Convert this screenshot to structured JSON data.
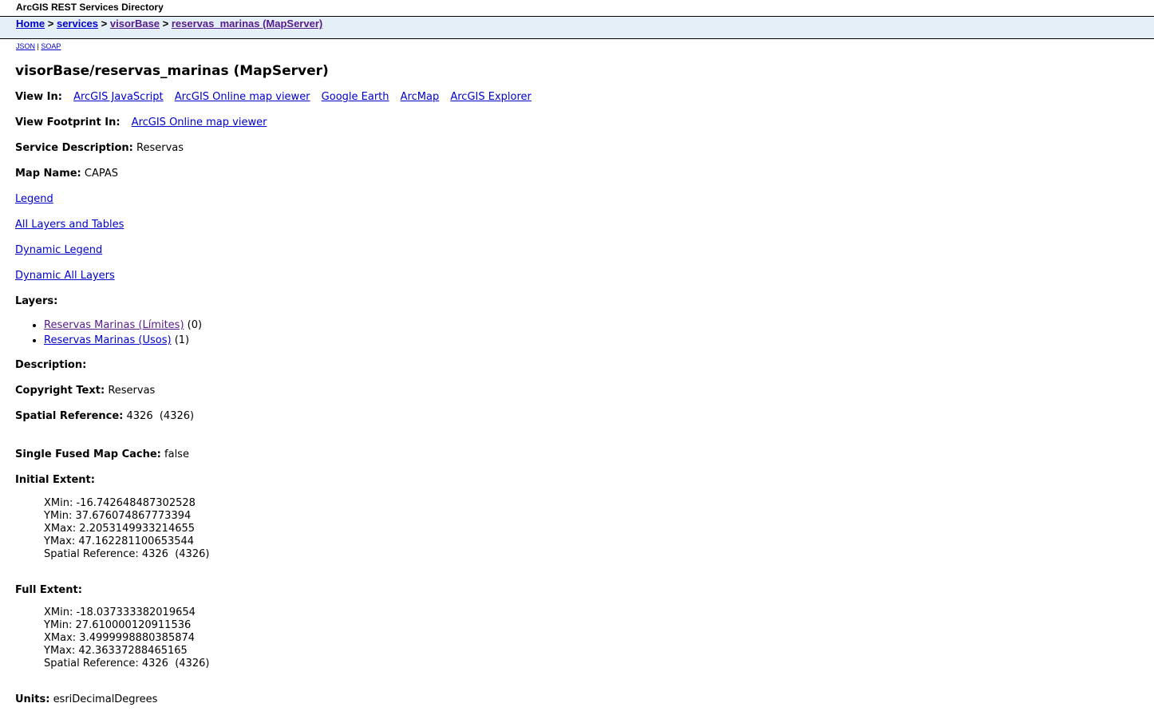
{
  "window": {
    "title": "ArcGIS REST Services Directory"
  },
  "breadcrumb": {
    "items": [
      {
        "label": "Home"
      },
      {
        "label": "services"
      },
      {
        "label": "visorBase"
      },
      {
        "label": "reservas_marinas (MapServer)"
      }
    ],
    "separator": ">"
  },
  "formats": {
    "json": "JSON",
    "separator": "|",
    "soap": "SOAP"
  },
  "page_title": "visorBase/reservas_marinas (MapServer)",
  "view_in": {
    "label": "View In:",
    "links": [
      "ArcGIS JavaScript",
      "ArcGIS Online map viewer",
      "Google Earth",
      "ArcMap",
      "ArcGIS Explorer"
    ]
  },
  "view_footprint": {
    "label": "View Footprint In:",
    "link": "ArcGIS Online map viewer"
  },
  "service_description": {
    "label": "Service Description:",
    "value": "Reservas"
  },
  "map_name": {
    "label": "Map Name:",
    "value": "CAPAS"
  },
  "links": {
    "legend": "Legend",
    "all_layers": "All Layers and Tables",
    "dynamic_legend": "Dynamic Legend",
    "dynamic_all_layers": "Dynamic All Layers"
  },
  "layers": {
    "label": "Layers:",
    "items": [
      {
        "name": "Reservas Marinas (Límites)",
        "id": "(0)"
      },
      {
        "name": "Reservas Marinas (Usos)",
        "id": "(1)"
      }
    ]
  },
  "description": {
    "label": "Description:"
  },
  "copyright": {
    "label": "Copyright Text:",
    "value": "Reservas"
  },
  "spatial_reference": {
    "label": "Spatial Reference:",
    "value": "4326  (4326)"
  },
  "single_fused": {
    "label": "Single Fused Map Cache:",
    "value": "false"
  },
  "initial_extent": {
    "label": "Initial Extent:",
    "xmin": "XMin: -16.742648487302528",
    "ymin": "YMin: 37.676074867773394",
    "xmax": "XMax: 2.2053149933214655",
    "ymax": "YMax: 47.162281100653544",
    "sr": "Spatial Reference: 4326  (4326)"
  },
  "full_extent": {
    "label": "Full Extent:",
    "xmin": "XMin: -18.037333382019654",
    "ymin": "YMin: 27.610000120911536",
    "xmax": "XMax: 3.4999998880385874",
    "ymax": "YMax: 42.36337288465165",
    "sr": "Spatial Reference: 4326  (4326)"
  },
  "units": {
    "label": "Units:",
    "value": "esriDecimalDegrees"
  }
}
